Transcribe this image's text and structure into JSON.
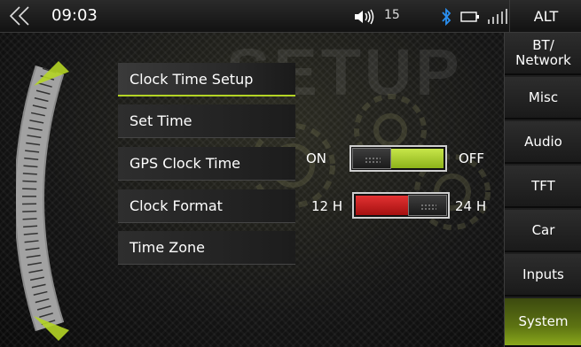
{
  "status": {
    "time": "09:03",
    "volume": "15",
    "alt_label": "ALT",
    "icons": [
      "back-chevron-icon",
      "volume-icon",
      "bluetooth-icon",
      "battery-icon",
      "signal-icon"
    ]
  },
  "watermark": "SETUP",
  "menu": [
    {
      "label": "Clock Time Setup",
      "active": true
    },
    {
      "label": "Set Time",
      "active": false
    },
    {
      "label": "GPS Clock Time",
      "active": false
    },
    {
      "label": "Clock Format",
      "active": false
    },
    {
      "label": "Time Zone",
      "active": false
    }
  ],
  "gps_toggle": {
    "left_label": "ON",
    "right_label": "OFF",
    "state": "ON"
  },
  "format_toggle": {
    "left_label": "12 H",
    "right_label": "24 H",
    "state": "12 H"
  },
  "tabs": [
    {
      "label": "BT/\nNetwork",
      "active": false
    },
    {
      "label": "Misc",
      "active": false
    },
    {
      "label": "Audio",
      "active": false
    },
    {
      "label": "TFT",
      "active": false
    },
    {
      "label": "Car",
      "active": false
    },
    {
      "label": "Inputs",
      "active": false
    },
    {
      "label": "System",
      "active": true
    }
  ],
  "colors": {
    "accent_green": "#b4d425",
    "toggle_green": "#9bc21b",
    "toggle_red": "#d01c1c"
  }
}
